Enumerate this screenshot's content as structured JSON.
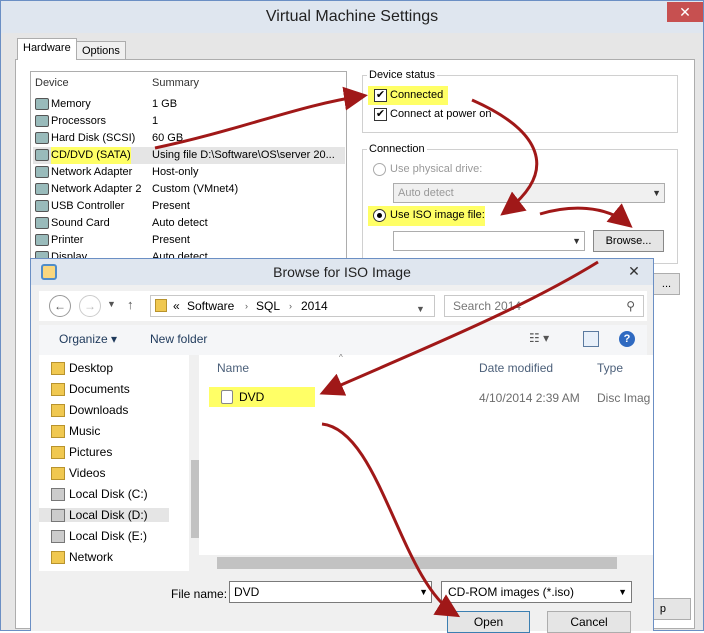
{
  "vm_window": {
    "title": "Virtual Machine Settings",
    "close_glyph": "✕",
    "tabs": [
      "Hardware",
      "Options"
    ],
    "device_list": {
      "header_device": "Device",
      "header_summary": "Summary",
      "rows": [
        {
          "name": "Memory",
          "summary": "1 GB",
          "icon": "memory-icon"
        },
        {
          "name": "Processors",
          "summary": "1",
          "icon": "processor-icon"
        },
        {
          "name": "Hard Disk (SCSI)",
          "summary": "60 GB",
          "icon": "hard-disk-icon"
        },
        {
          "name": "CD/DVD (SATA)",
          "summary": "Using file D:\\Software\\OS\\server 20...",
          "icon": "cd-dvd-icon",
          "selected": true
        },
        {
          "name": "Network Adapter",
          "summary": "Host-only",
          "icon": "network-adapter-icon"
        },
        {
          "name": "Network Adapter 2",
          "summary": "Custom (VMnet4)",
          "icon": "network-adapter-icon"
        },
        {
          "name": "USB Controller",
          "summary": "Present",
          "icon": "usb-icon"
        },
        {
          "name": "Sound Card",
          "summary": "Auto detect",
          "icon": "sound-icon"
        },
        {
          "name": "Printer",
          "summary": "Present",
          "icon": "printer-icon"
        },
        {
          "name": "Display",
          "summary": "Auto detect",
          "icon": "display-icon"
        }
      ]
    },
    "device_status": {
      "legend": "Device status",
      "connected_label": "Connected",
      "connected_checked": true,
      "connect_power_label": "Connect at power on",
      "connect_power_checked": true
    },
    "connection": {
      "legend": "Connection",
      "physical_label": "Use physical drive:",
      "physical_value": "Auto detect",
      "iso_label": "Use ISO image file:",
      "iso_value": "",
      "browse_label": "Browse...",
      "more_label": "...",
      "partial_button": "p"
    }
  },
  "browse_dialog": {
    "title": "Browse for ISO Image",
    "close_glyph": "✕",
    "back_glyph": "←",
    "forward_glyph": "→",
    "up_glyph": "↑",
    "breadcrumb": [
      "Software",
      "SQL",
      "2014"
    ],
    "breadcrumb_prefix": "«",
    "search_placeholder": "Search 2014",
    "organize_label": "Organize ▾",
    "new_folder_label": "New folder",
    "help_glyph": "?",
    "nav_items": [
      {
        "label": "Desktop",
        "icon": "desktop-icon",
        "drive": false
      },
      {
        "label": "Documents",
        "icon": "documents-icon",
        "drive": false
      },
      {
        "label": "Downloads",
        "icon": "downloads-icon",
        "drive": false
      },
      {
        "label": "Music",
        "icon": "music-icon",
        "drive": false
      },
      {
        "label": "Pictures",
        "icon": "pictures-icon",
        "drive": false
      },
      {
        "label": "Videos",
        "icon": "videos-icon",
        "drive": false
      },
      {
        "label": "Local Disk (C:)",
        "icon": "drive-icon",
        "drive": true
      },
      {
        "label": "Local Disk (D:)",
        "icon": "drive-icon",
        "drive": true,
        "selected": true
      },
      {
        "label": "Local Disk (E:)",
        "icon": "drive-icon",
        "drive": true
      },
      {
        "label": "Network",
        "icon": "network-icon",
        "drive": false
      }
    ],
    "columns": {
      "name": "Name",
      "date": "Date modified",
      "type": "Type"
    },
    "files": [
      {
        "name": "DVD",
        "date": "4/10/2014 2:39 AM",
        "type": "Disc Imag",
        "icon": "disc-image-icon"
      }
    ],
    "file_name_label": "File name:",
    "file_name_value": "DVD",
    "file_type_value": "CD-ROM images (*.iso)",
    "open_label": "Open",
    "cancel_label": "Cancel"
  },
  "colors": {
    "highlight": "#ffff66",
    "arrow": "#a01818"
  }
}
